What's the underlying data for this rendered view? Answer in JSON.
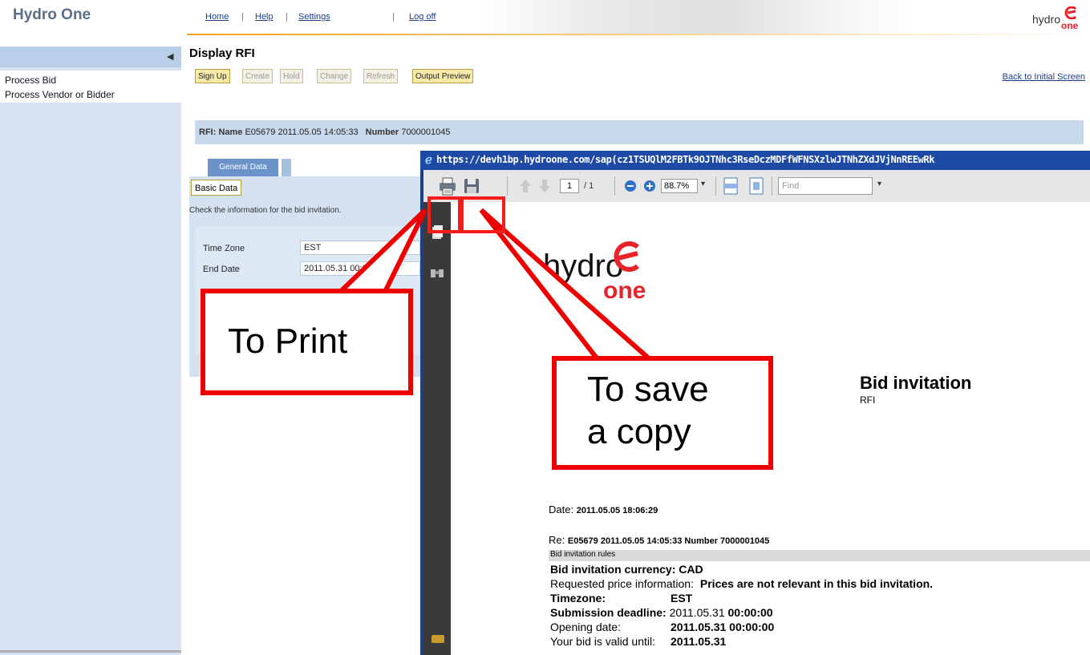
{
  "header": {
    "brand": "Hydro One",
    "nav": [
      "Home",
      "Help",
      "Settings",
      "Log off"
    ],
    "logo_text_hydro": "hydro",
    "logo_text_one": "one"
  },
  "sidebar": {
    "items": [
      "Process Bid",
      "Process Vendor or Bidder"
    ]
  },
  "main": {
    "title": "Display RFI",
    "toolbar": [
      {
        "label": "Sign Up",
        "enabled": true
      },
      {
        "label": "Create",
        "enabled": false
      },
      {
        "label": "Hold",
        "enabled": false
      },
      {
        "label": "Change",
        "enabled": false
      },
      {
        "label": "Refresh",
        "enabled": false
      },
      {
        "label": "Output Preview",
        "enabled": true
      }
    ],
    "back_link": "Back to Initial Screen",
    "rfi": {
      "name_label": "RFI: Name",
      "name_value": "E05679 2011.05.05 14:05:33",
      "number_label": "Number",
      "number_value": "7000001045"
    },
    "tab": "General Data",
    "basic_data": "Basic Data",
    "check_text": "Check the information for the bid invitation.",
    "fields": [
      {
        "label": "Time Zone",
        "value": "EST"
      },
      {
        "label": "End Date",
        "value": "2011.05.31 00:00:00"
      }
    ]
  },
  "pdf": {
    "url": "https://devh1bp.hydroone.com/sap(cz1TSUQlM2FBTk9OJTNhc3RseDczMDFfWFNSXzlwJTNhZXdJVjNnREEwRk",
    "page_current": "1",
    "page_total": "/ 1",
    "zoom": "88.7%",
    "find_placeholder": "Find",
    "doc": {
      "logo_hydro": "hydro",
      "logo_one": "one",
      "title": "Bid invitation",
      "subtitle": "RFI",
      "date_label": "Date:",
      "date_value": "2011.05.05 18:06:29",
      "re_label": "Re:",
      "re_value": "E05679 2011.05.05 14:05:33 Number 7000001045",
      "rules_heading": "Bid invitation rules",
      "currency": "Bid invitation currency: CAD",
      "price_label": "Requested price information:",
      "price_value": "Prices are not relevant in this bid invitation.",
      "tz_label": "Timezone:",
      "tz_value": "EST",
      "deadline_label": "Submission deadline:",
      "deadline_date": "2011.05.31",
      "deadline_time": "00:00:00",
      "opening_label": "Opening date:",
      "opening_value": "2011.05.31 00:00:00",
      "valid_label": "Your bid is valid until:",
      "valid_value": "2011.05.31"
    }
  },
  "annotations": {
    "print_callout": "To Print",
    "save_callout_line1": "To save",
    "save_callout_line2": "a copy"
  },
  "colors": {
    "brand_accent": "#e8232a",
    "annotation_red": "#ee0000",
    "sidebar_bg": "#d8e4f3",
    "ie_title_bar": "#1e4aa6"
  }
}
